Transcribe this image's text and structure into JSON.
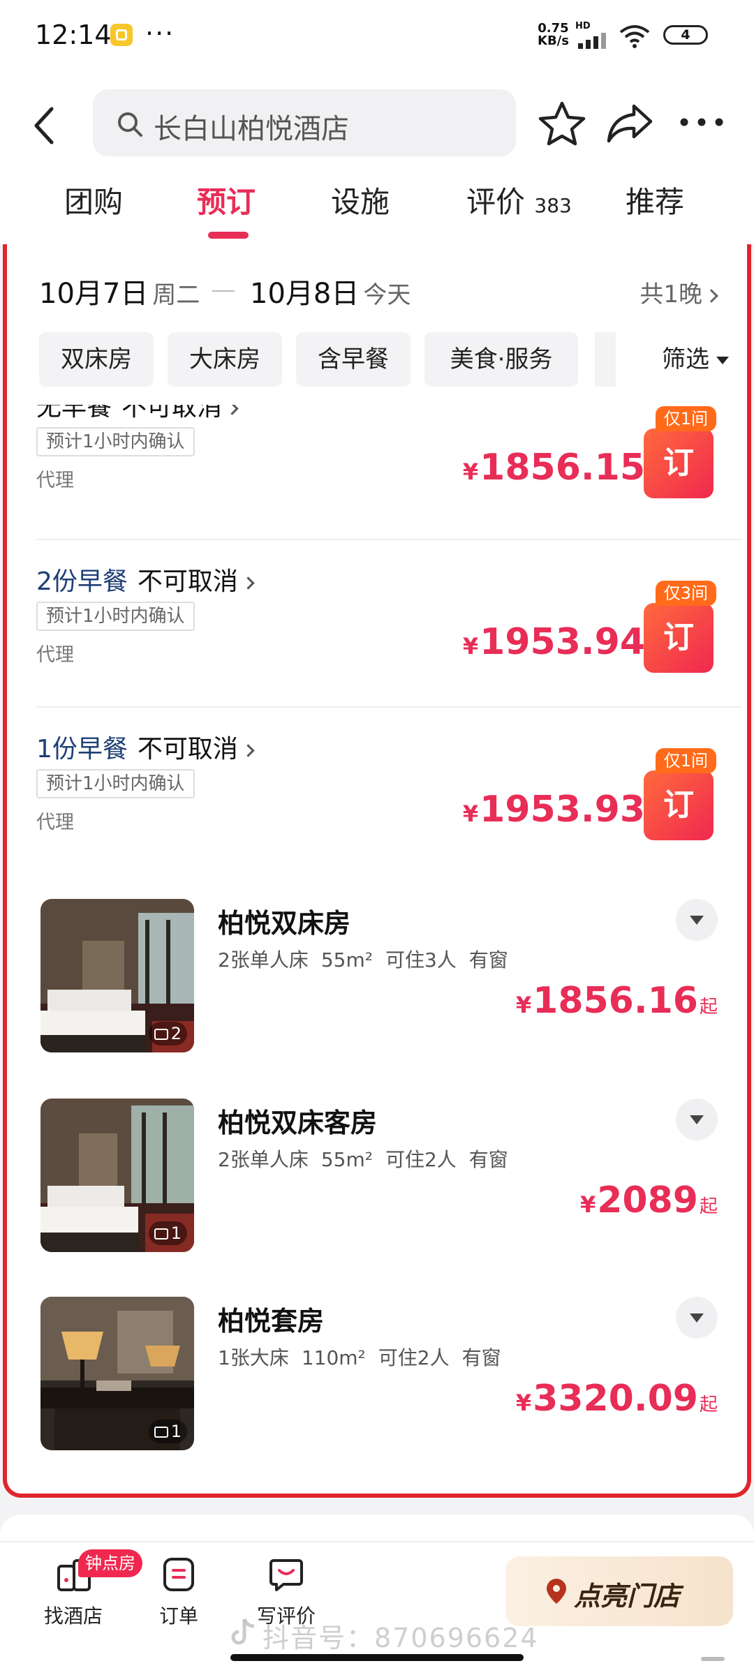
{
  "status_bar": {
    "time": "12:14",
    "dots": "···",
    "speed_value": "0.75",
    "speed_unit": "KB/s",
    "network": "HD",
    "battery": "4"
  },
  "header": {
    "search_text": "长白山柏悦酒店",
    "icons": [
      "back-icon",
      "star-icon",
      "share-icon",
      "more-icon"
    ]
  },
  "tabs": [
    {
      "label": "团购"
    },
    {
      "label": "预订",
      "active": true
    },
    {
      "label": "设施"
    },
    {
      "label": "评价",
      "count": "383"
    },
    {
      "label": "推荐"
    }
  ],
  "dates": {
    "start_date": "10月7日",
    "start_weekday": "周二",
    "end_date": "10月8日",
    "end_weekday": "今天",
    "nights": "共1晚"
  },
  "filters": {
    "chips": [
      "双床房",
      "大床房",
      "含早餐",
      "美食·服务"
    ],
    "filter_label": "筛选"
  },
  "rate_plans": [
    {
      "meal": "无早餐",
      "policy": "不可取消",
      "confirm": "预计1小时内确认",
      "channel": "代理",
      "price": "1856.15",
      "currency": "¥",
      "badge": "仅1间",
      "book_label": "订"
    },
    {
      "meal": "2份早餐",
      "policy": "不可取消",
      "confirm": "预计1小时内确认",
      "channel": "代理",
      "price": "1953.94",
      "currency": "¥",
      "badge": "仅3间",
      "book_label": "订"
    },
    {
      "meal": "1份早餐",
      "policy": "不可取消",
      "confirm": "预计1小时内确认",
      "channel": "代理",
      "price": "1953.93",
      "currency": "¥",
      "badge": "仅1间",
      "book_label": "订"
    }
  ],
  "rooms": [
    {
      "name": "柏悦双床房",
      "bed": "2张单人床",
      "area": "55m²",
      "occupancy": "可住3人",
      "window": "有窗",
      "price": "1856.16",
      "currency": "¥",
      "suffix": "起",
      "photo_count": "2"
    },
    {
      "name": "柏悦双床客房",
      "bed": "2张单人床",
      "area": "55m²",
      "occupancy": "可住2人",
      "window": "有窗",
      "price": "2089",
      "currency": "¥",
      "suffix": "起",
      "photo_count": "1"
    },
    {
      "name": "柏悦套房",
      "bed": "1张大床",
      "area": "110m²",
      "occupancy": "可住2人",
      "window": "有窗",
      "price": "3320.09",
      "currency": "¥",
      "suffix": "起",
      "photo_count": "1"
    }
  ],
  "bottom_nav": {
    "items": [
      {
        "label": "找酒店",
        "badge": "钟点房"
      },
      {
        "label": "订单"
      },
      {
        "label": "写评价"
      }
    ],
    "light_store": "点亮门店"
  },
  "watermark": "抖音号：870696624",
  "colors": {
    "accent": "#e82d57",
    "panel_border": "#e0252d",
    "meal_text": "#1e3f75",
    "badge_orange": "#ff6b1a"
  }
}
